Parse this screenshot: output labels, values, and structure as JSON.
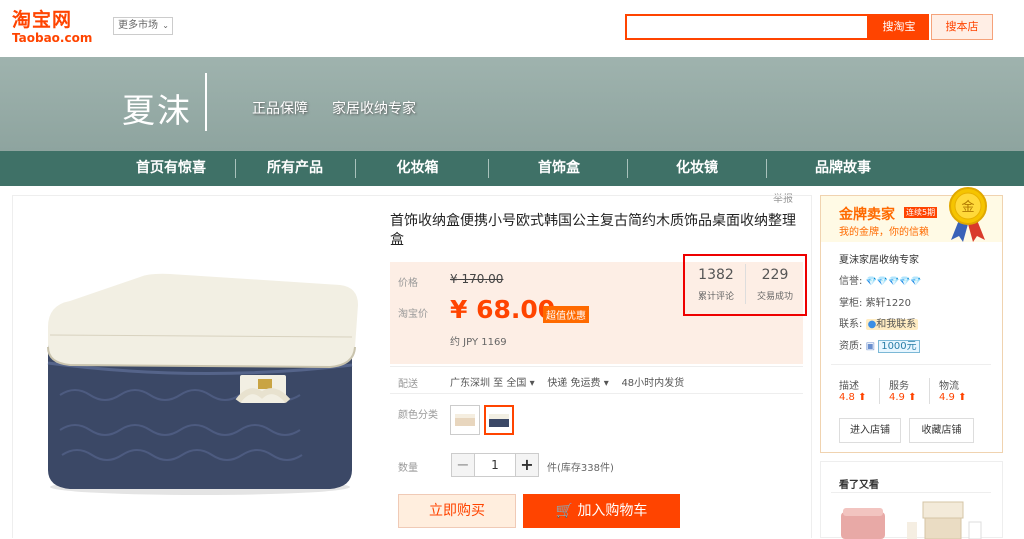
{
  "header": {
    "logo_cn": "淘宝网",
    "logo_en": "Taobao.com",
    "more_market": "更多市场",
    "search_tb": "搜淘宝",
    "search_shop": "搜本店",
    "search_value": ""
  },
  "banner": {
    "brand": "夏沫",
    "slogan1": "正品保障",
    "slogan2": "家居收纳专家"
  },
  "nav": {
    "items": [
      "首页有惊喜",
      "所有产品",
      "化妆箱",
      "首饰盒",
      "化妆镜",
      "品牌故事"
    ]
  },
  "report": "举报",
  "product": {
    "title": "首饰收纳盒便携小号欧式韩国公主复古简约木质饰品桌面收纳整理盒",
    "price_label": "价格",
    "orig_price": "¥ 170.00",
    "tb_price_label": "淘宝价",
    "promo_price": "¥ 68.00",
    "promo_badge": "超值优惠",
    "jpy_price": "约 JPY 1169",
    "reviews_count": "1382",
    "reviews_label": "累计评论",
    "deals_count": "229",
    "deals_label": "交易成功",
    "delivery_label": "配送",
    "delivery_from": "广东深圳 至",
    "delivery_to": "全国",
    "delivery_method": "快递 免运费",
    "delivery_time": "48小时内发货",
    "color_label": "颜色分类",
    "qty_label": "数量",
    "qty_value": "1",
    "qty_minus": "−",
    "qty_plus": "+",
    "stock": "件(库存338件)",
    "buy_now": "立即购买",
    "add_cart": "加入购物车"
  },
  "seller": {
    "gold_title": "金牌卖家",
    "gold_tag": "连续5期",
    "gold_sub": "我的金牌，你的信赖",
    "medal_char": "金",
    "shop_name": "夏沫家居收纳专家",
    "credit_label": "信誉:",
    "credit_diamonds": "💎💎💎💎💎",
    "keeper_label": "掌柜:",
    "keeper_name": "紫轩1220",
    "contact_label": "联系:",
    "contact_btn": "和我联系",
    "qual_label": "资质:",
    "qual_value": "1000元",
    "rating_desc_label": "描述",
    "rating_desc_value": "4.8 ⬆",
    "rating_service_label": "服务",
    "rating_service_value": "4.9 ⬆",
    "rating_logistics_label": "物流",
    "rating_logistics_value": "4.9 ⬆",
    "enter_shop": "进入店铺",
    "fav_shop": "收藏店铺"
  },
  "also_viewed": {
    "title": "看了又看"
  },
  "colors": {
    "accent": "#ff4400",
    "nav_bg": "#3f7167",
    "banner_bg": "#97ada8"
  }
}
